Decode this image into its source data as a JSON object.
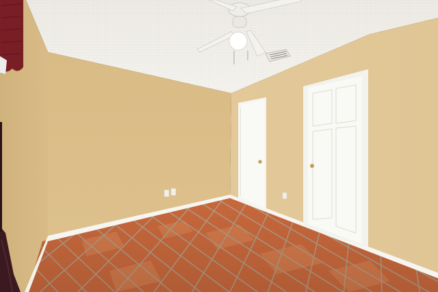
{
  "scene": {
    "subject": "empty-bedroom-interior",
    "colors": {
      "wall": "#e0c595",
      "wall_shadow": "#cdb079",
      "ceiling": "#f1efe8",
      "door": "#f7f7f3",
      "trim": "#f6f5f0",
      "floor_tile": "#c8683c",
      "floor_tile_light": "#d98555",
      "grout": "#b09b82",
      "curtain": "#7a1e26",
      "drape": "#3a1a20",
      "door_knob": "#c0a050"
    },
    "elements": [
      "ceiling-fan",
      "ceiling-air-vent",
      "textured-ceiling",
      "left-wall",
      "back-wall",
      "right-wall",
      "left-closet-door",
      "right-door",
      "electrical-outlet",
      "baseboard",
      "terracotta-tile-floor",
      "window-valance",
      "drape"
    ]
  }
}
